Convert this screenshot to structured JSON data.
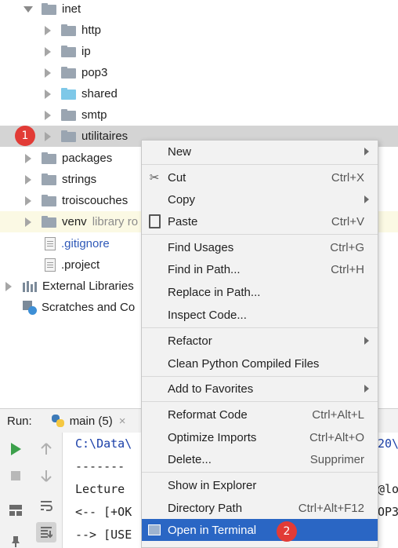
{
  "tree": {
    "items": [
      {
        "label": "inet",
        "expanded": true
      },
      {
        "label": "http"
      },
      {
        "label": "ip"
      },
      {
        "label": "pop3"
      },
      {
        "label": "shared"
      },
      {
        "label": "smtp"
      },
      {
        "label": "utilitaires"
      },
      {
        "label": "packages"
      },
      {
        "label": "strings"
      },
      {
        "label": "troiscouches"
      },
      {
        "label": "venv",
        "suffix": "library ro"
      },
      {
        "label": ".gitignore"
      },
      {
        "label": ".project"
      },
      {
        "label": "External Libraries"
      },
      {
        "label": "Scratches and Co"
      }
    ]
  },
  "badges": {
    "one": "1",
    "two": "2"
  },
  "run": {
    "title": "Run:",
    "tab_label": "main (5)",
    "tab_close": "×",
    "console_lines": [
      "C:\\Data\\",
      "-------",
      "Lecture",
      "<-- [+OK",
      "--> [USE"
    ],
    "right_frag": [
      "20\\",
      "",
      "@lo",
      "OP3",
      ""
    ]
  },
  "menu": {
    "items": [
      {
        "label": "New",
        "shortcut": "",
        "submenu": true
      },
      {
        "label": "Cut",
        "shortcut": "Ctrl+X",
        "icon": "scissors-icon"
      },
      {
        "label": "Copy",
        "shortcut": "",
        "submenu": true
      },
      {
        "label": "Paste",
        "shortcut": "Ctrl+V",
        "icon": "clipboard-icon"
      },
      {
        "label": "Find Usages",
        "shortcut": "Ctrl+G"
      },
      {
        "label": "Find in Path...",
        "shortcut": "Ctrl+H"
      },
      {
        "label": "Replace in Path..."
      },
      {
        "label": "Inspect Code..."
      },
      {
        "label": "Refactor",
        "submenu": true
      },
      {
        "label": "Clean Python Compiled Files"
      },
      {
        "label": "Add to Favorites",
        "submenu": true
      },
      {
        "label": "Reformat Code",
        "shortcut": "Ctrl+Alt+L"
      },
      {
        "label": "Optimize Imports",
        "shortcut": "Ctrl+Alt+O"
      },
      {
        "label": "Delete...",
        "shortcut": "Supprimer"
      },
      {
        "label": "Show in Explorer"
      },
      {
        "label": "Directory Path",
        "shortcut": "Ctrl+Alt+F12"
      },
      {
        "label": "Open in Terminal",
        "selected": true
      }
    ]
  },
  "colors": {
    "selection": "#2a66c4",
    "badge": "#e23b36",
    "link": "#2f59b8"
  }
}
